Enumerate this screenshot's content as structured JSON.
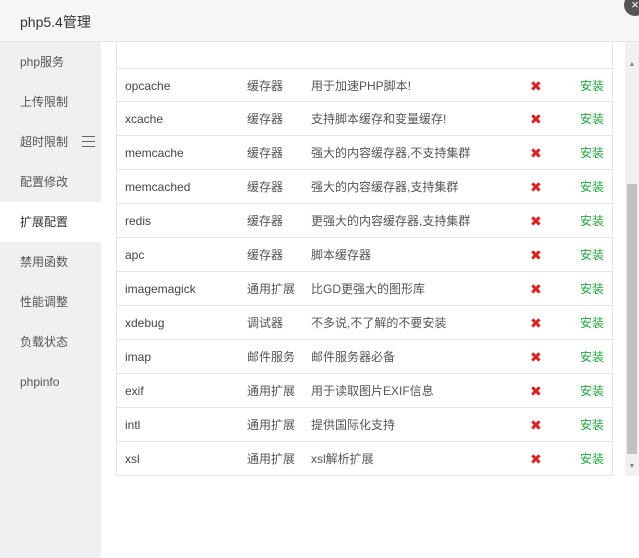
{
  "window": {
    "title": "php5.4管理",
    "close_glyph": "×"
  },
  "sidebar": {
    "items": [
      {
        "label": "php服务"
      },
      {
        "label": "上传限制"
      },
      {
        "label": "超时限制"
      },
      {
        "label": "配置修改"
      },
      {
        "label": "扩展配置",
        "active": true
      },
      {
        "label": "禁用函数"
      },
      {
        "label": "性能调整"
      },
      {
        "label": "负载状态"
      },
      {
        "label": "phpinfo"
      }
    ]
  },
  "extensions": {
    "status_glyph": "✖",
    "action_label": "安装",
    "rows": [
      {
        "name": "opcache",
        "type": "缓存器",
        "desc": "用于加速PHP脚本!"
      },
      {
        "name": "xcache",
        "type": "缓存器",
        "desc": "支持脚本缓存和变量缓存!"
      },
      {
        "name": "memcache",
        "type": "缓存器",
        "desc": "强大的内容缓存器,不支持集群"
      },
      {
        "name": "memcached",
        "type": "缓存器",
        "desc": "强大的内容缓存器,支持集群"
      },
      {
        "name": "redis",
        "type": "缓存器",
        "desc": "更强大的内容缓存器,支持集群"
      },
      {
        "name": "apc",
        "type": "缓存器",
        "desc": "脚本缓存器"
      },
      {
        "name": "imagemagick",
        "type": "通用扩展",
        "desc": "比GD更强大的图形库"
      },
      {
        "name": "xdebug",
        "type": "调试器",
        "desc": "不多说,不了解的不要安装"
      },
      {
        "name": "imap",
        "type": "邮件服务",
        "desc": "邮件服务器必备"
      },
      {
        "name": "exif",
        "type": "通用扩展",
        "desc": "用于读取图片EXIF信息"
      },
      {
        "name": "intl",
        "type": "通用扩展",
        "desc": "提供国际化支持"
      },
      {
        "name": "xsl",
        "type": "通用扩展",
        "desc": "xsl解析扩展"
      }
    ]
  },
  "scrollbar": {
    "up_glyph": "▲",
    "down_glyph": "▼"
  },
  "colors": {
    "status_missing": "#e02020",
    "install_link": "#20a53a"
  }
}
